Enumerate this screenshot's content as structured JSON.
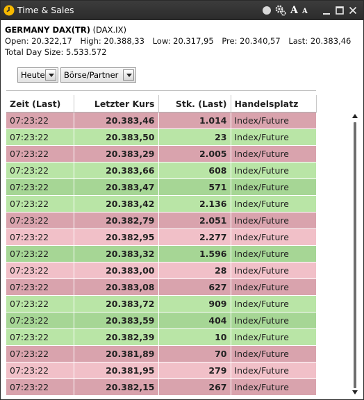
{
  "window": {
    "title": "Time & Sales",
    "font_smaller_label": "A",
    "font_larger_label": "A"
  },
  "instrument": {
    "name": "GERMANY DAX(TR)",
    "symbol": "(DAX.IX)"
  },
  "stats": {
    "open": "Open: 20.322,17",
    "high": "High: 20.388,33",
    "low": "Low: 20.317,95",
    "pre": "Pre: 20.340,57",
    "last": "Last: 20.383,46",
    "total_day_size": "Total Day Size: 5.533.572"
  },
  "filters": {
    "period": "Heute",
    "venue": "Börse/Partner"
  },
  "table": {
    "headers": [
      "Zeit (Last)",
      "Letzter Kurs",
      "Stk. (Last)",
      "Handelsplatz"
    ],
    "rows": [
      {
        "time": "07:23:22",
        "price": "20.383,46",
        "size": "1.014",
        "venue": "Index/Future",
        "color": "red"
      },
      {
        "time": "07:23:22",
        "price": "20.383,50",
        "size": "23",
        "venue": "Index/Future",
        "color": "green"
      },
      {
        "time": "07:23:22",
        "price": "20.383,29",
        "size": "2.005",
        "venue": "Index/Future",
        "color": "red"
      },
      {
        "time": "07:23:22",
        "price": "20.383,66",
        "size": "608",
        "venue": "Index/Future",
        "color": "green"
      },
      {
        "time": "07:23:22",
        "price": "20.383,47",
        "size": "571",
        "venue": "Index/Future",
        "color": "dgreen"
      },
      {
        "time": "07:23:22",
        "price": "20.383,42",
        "size": "2.136",
        "venue": "Index/Future",
        "color": "green"
      },
      {
        "time": "07:23:22",
        "price": "20.382,79",
        "size": "2.051",
        "venue": "Index/Future",
        "color": "red"
      },
      {
        "time": "07:23:22",
        "price": "20.382,95",
        "size": "2.277",
        "venue": "Index/Future",
        "color": "pink"
      },
      {
        "time": "07:23:22",
        "price": "20.383,32",
        "size": "1.596",
        "venue": "Index/Future",
        "color": "dgreen"
      },
      {
        "time": "07:23:22",
        "price": "20.383,00",
        "size": "28",
        "venue": "Index/Future",
        "color": "pink"
      },
      {
        "time": "07:23:22",
        "price": "20.383,08",
        "size": "627",
        "venue": "Index/Future",
        "color": "red"
      },
      {
        "time": "07:23:22",
        "price": "20.383,72",
        "size": "909",
        "venue": "Index/Future",
        "color": "green"
      },
      {
        "time": "07:23:22",
        "price": "20.383,59",
        "size": "404",
        "venue": "Index/Future",
        "color": "dgreen"
      },
      {
        "time": "07:23:22",
        "price": "20.382,39",
        "size": "10",
        "venue": "Index/Future",
        "color": "green"
      },
      {
        "time": "07:23:22",
        "price": "20.381,89",
        "size": "70",
        "venue": "Index/Future",
        "color": "red"
      },
      {
        "time": "07:23:22",
        "price": "20.381,95",
        "size": "279",
        "venue": "Index/Future",
        "color": "pink"
      },
      {
        "time": "07:23:22",
        "price": "20.382,15",
        "size": "267",
        "venue": "Index/Future",
        "color": "red"
      }
    ]
  },
  "colors": {
    "sell": "#d9a3ad",
    "sell_light": "#f1c0c8",
    "buy": "#b9e5a6",
    "buy_dark": "#a6d695",
    "titlebar": "#2b2b2b",
    "title_icon": "#f5b800"
  },
  "icons": [
    "clock-icon",
    "status-dot-icon",
    "settings-gear-icon",
    "font-larger-icon",
    "font-smaller-icon",
    "minimize-icon",
    "maximize-icon",
    "close-icon",
    "dropdown-arrow-icon",
    "scroll-up-icon",
    "scroll-down-icon"
  ]
}
